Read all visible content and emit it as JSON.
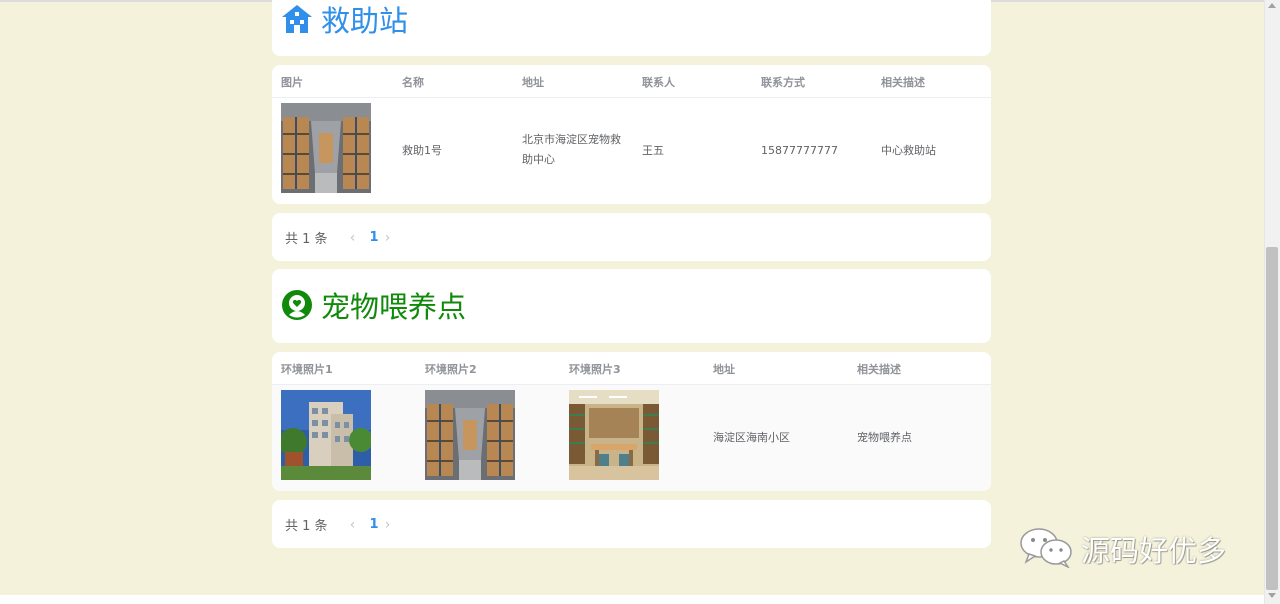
{
  "section1": {
    "title": "救助站",
    "icon": "home-icon",
    "color": "#2f8fea",
    "columns": [
      "图片",
      "名称",
      "地址",
      "联系人",
      "联系方式",
      "相关描述"
    ],
    "rows": [
      {
        "image": "warehouse-image",
        "name": "救助1号",
        "address_line1": "北京市海淀区宠物救",
        "address_line2": "助中心",
        "contact": "王五",
        "phone": "15877777777",
        "desc": "中心救助站"
      }
    ],
    "pager": {
      "total": "共 1 条",
      "current": "1",
      "prev_icon": "chevron-left-icon",
      "next_icon": "chevron-right-icon"
    }
  },
  "section2": {
    "title": "宠物喂养点",
    "icon": "pet-heart-icon",
    "color": "#118a0c",
    "columns": [
      "环境照片1",
      "环境照片2",
      "环境照片3",
      "地址",
      "相关描述"
    ],
    "rows": [
      {
        "photo1": "building-image",
        "photo2": "warehouse-image",
        "photo3": "library-image",
        "address": "海淀区海南小区",
        "desc": "宠物喂养点"
      }
    ],
    "pager": {
      "total": "共 1 条",
      "current": "1",
      "prev_icon": "chevron-left-icon",
      "next_icon": "chevron-right-icon"
    }
  },
  "watermark": {
    "icon": "wechat-icon",
    "text": "源码好优多"
  }
}
